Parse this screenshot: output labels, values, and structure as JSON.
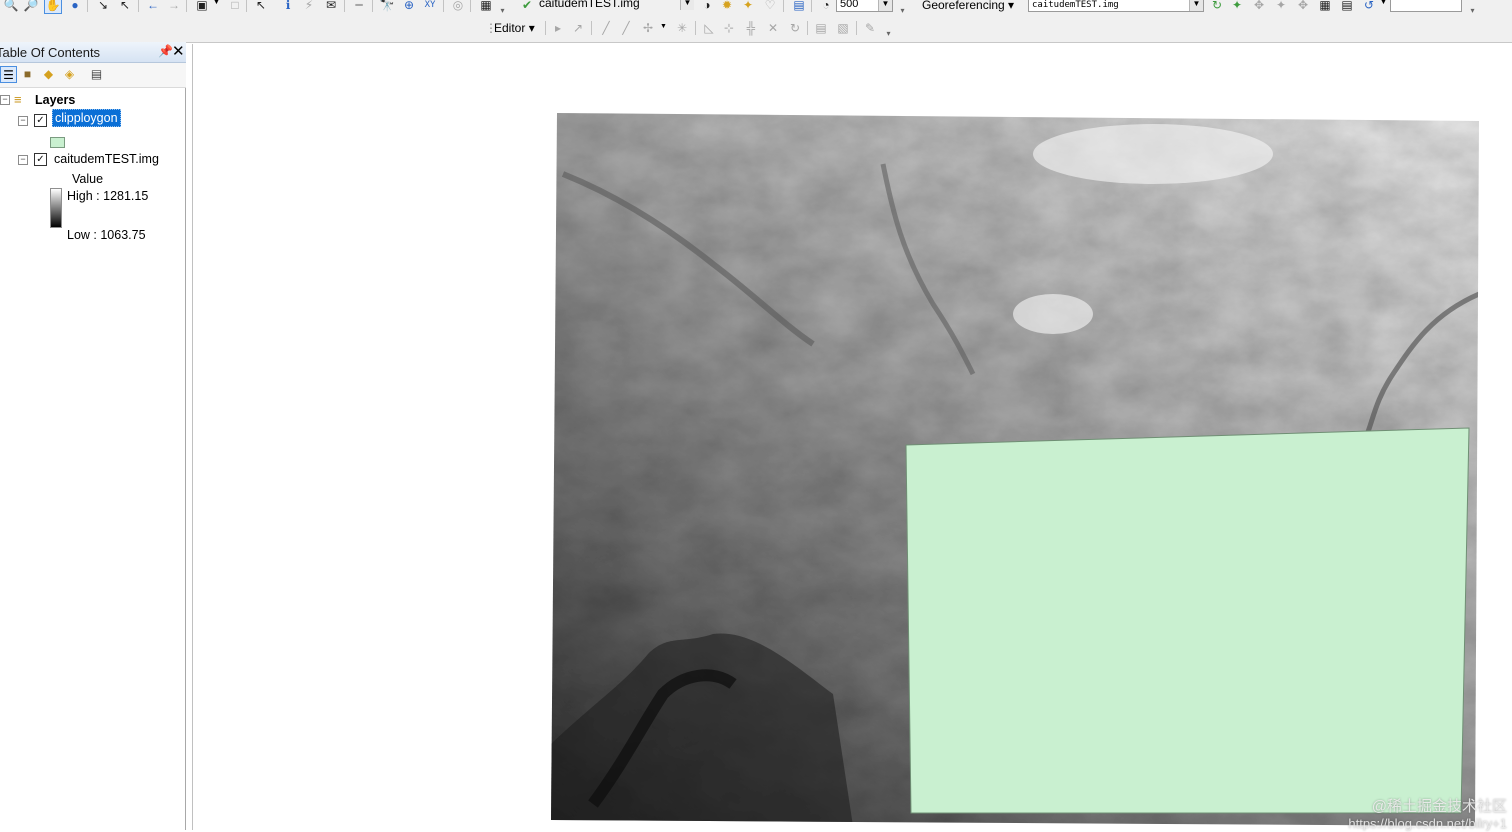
{
  "toolbar": {
    "layer_combo": "caitudemTEST.img",
    "scale_combo": "500",
    "editor_label": "Editor",
    "georef_label": "Georeferencing",
    "georef_layer_combo": "caitudemTEST.img",
    "blank_combo": ""
  },
  "toc": {
    "title": "Table Of Contents",
    "layers_label": "Layers",
    "layer1": {
      "name": "clipploygon",
      "checked": true,
      "swatch_color": "#c9f0d0"
    },
    "layer2": {
      "name": "caitudemTEST.img",
      "checked": true,
      "legend_title": "Value",
      "high_label": "High : 1281.15",
      "low_label": "Low : 1063.75"
    }
  },
  "map": {
    "dem_layer": "caitudemTEST.img",
    "polygon_layer": "clipploygon",
    "polygon_fill": "#c9f0d0",
    "watermark_line1": "@稀土掘金技术社区",
    "watermark_line2": "https://blog.csdn.net/bilry+1"
  },
  "icons": [
    "zoom-in-icon",
    "zoom-out-icon",
    "pan-icon",
    "globe-icon",
    "fixed-zoom-in-icon",
    "fixed-zoom-out-icon",
    "back-icon",
    "forward-icon",
    "select-features-icon",
    "clear-selection-icon",
    "select-elements-icon",
    "identify-icon",
    "hyperlink-icon",
    "html-popup-icon",
    "measure-icon",
    "find-icon",
    "go-to-xy-icon",
    "time-slider-icon",
    "editor-arrow-icon",
    "pin-icon",
    "close-icon"
  ]
}
